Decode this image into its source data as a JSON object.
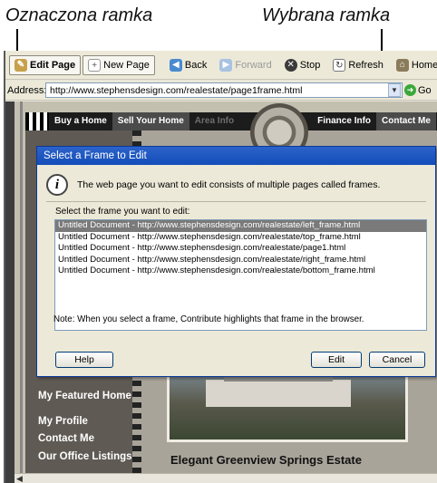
{
  "callouts": {
    "left": "Oznaczona ramka",
    "right": "Wybrana ramka"
  },
  "toolbar": {
    "edit_page": "Edit Page",
    "new_page": "New Page",
    "back": "Back",
    "forward": "Forward",
    "stop": "Stop",
    "refresh": "Refresh",
    "home_pages": "Home Pages"
  },
  "address": {
    "label": "Address:",
    "url": "http://www.stephensdesign.com/realestate/page1frame.html",
    "go": "Go"
  },
  "site": {
    "nav": [
      "Buy a Home",
      "Sell Your Home",
      "Area Info",
      "Finance Info",
      "Contact Me"
    ],
    "sidebar": [
      "My Featured Home",
      "My Profile",
      "Contact Me",
      "Our Office Listings"
    ],
    "headline": "Elegant Greenview Springs Estate"
  },
  "dialog": {
    "title": "Select a Frame to Edit",
    "info": "The web page you want to edit consists of multiple pages called frames.",
    "select_label": "Select the frame you want to edit:",
    "frames": [
      "Untitled Document - http://www.stephensdesign.com/realestate/left_frame.html",
      "Untitled Document - http://www.stephensdesign.com/realestate/top_frame.html",
      "Untitled Document - http://www.stephensdesign.com/realestate/page1.html",
      "Untitled Document - http://www.stephensdesign.com/realestate/right_frame.html",
      "Untitled Document - http://www.stephensdesign.com/realestate/bottom_frame.html"
    ],
    "note": "Note: When you select a frame, Contribute highlights that frame in the browser.",
    "help": "Help",
    "edit": "Edit",
    "cancel": "Cancel"
  },
  "colors": {
    "title_bar": "#144db8",
    "selection": "#7a7a7a",
    "dialog_bg": "#ece9d8"
  }
}
